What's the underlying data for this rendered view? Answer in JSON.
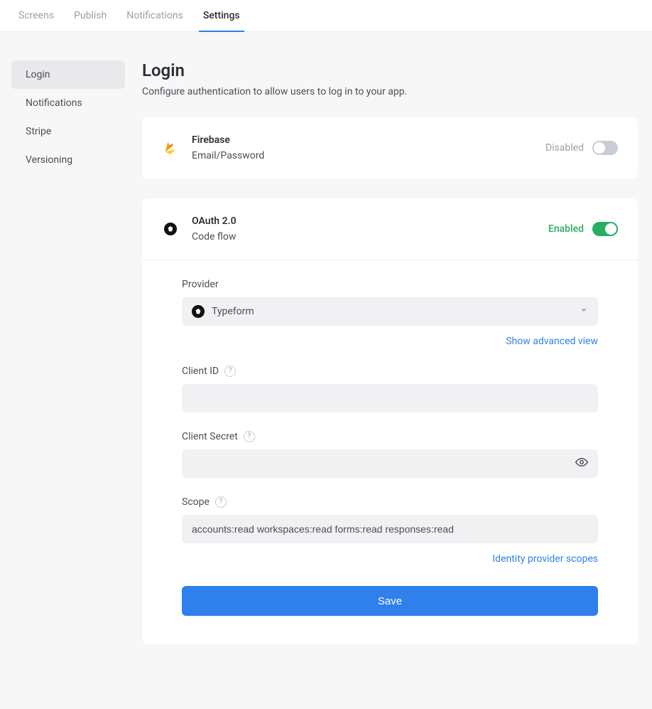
{
  "tabs": {
    "items": [
      {
        "label": "Screens",
        "active": false
      },
      {
        "label": "Publish",
        "active": false
      },
      {
        "label": "Notifications",
        "active": false
      },
      {
        "label": "Settings",
        "active": true
      }
    ]
  },
  "sidebar": {
    "items": [
      {
        "label": "Login",
        "active": true
      },
      {
        "label": "Notifications",
        "active": false
      },
      {
        "label": "Stripe",
        "active": false
      },
      {
        "label": "Versioning",
        "active": false
      }
    ]
  },
  "header": {
    "title": "Login",
    "desc": "Configure authentication to allow users to log in to your app."
  },
  "firebase": {
    "title": "Firebase",
    "sub": "Email/Password",
    "state_label": "Disabled",
    "enabled": false
  },
  "oauth": {
    "title": "OAuth 2.0",
    "sub": "Code flow",
    "state_label": "Enabled",
    "enabled": true,
    "provider_label": "Provider",
    "provider_value": "Typeform",
    "advanced_link": "Show advanced view",
    "client_id_label": "Client ID",
    "client_id_value": "",
    "client_secret_label": "Client Secret",
    "client_secret_value": "",
    "scope_label": "Scope",
    "scope_value": "accounts:read workspaces:read forms:read responses:read",
    "scope_link": "Identity provider scopes",
    "save_label": "Save"
  }
}
